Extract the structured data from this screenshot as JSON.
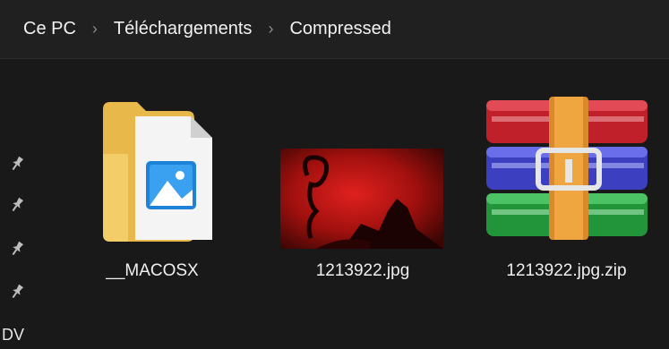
{
  "breadcrumb": {
    "items": [
      "Ce PC",
      "Téléchargements",
      "Compressed"
    ],
    "separator": "›"
  },
  "nav": {
    "truncated_label": "DV",
    "pin_icon": "pin-icon"
  },
  "files": [
    {
      "name": "__MACOSX",
      "type": "folder",
      "icon": "folder-with-image-icon"
    },
    {
      "name": "1213922.jpg",
      "type": "image",
      "icon": "image-thumbnail"
    },
    {
      "name": "1213922.jpg.zip",
      "type": "archive",
      "icon": "winrar-archive-icon"
    }
  ],
  "colors": {
    "background": "#191919",
    "addressbar": "#202020",
    "text": "#f0f0f0"
  }
}
